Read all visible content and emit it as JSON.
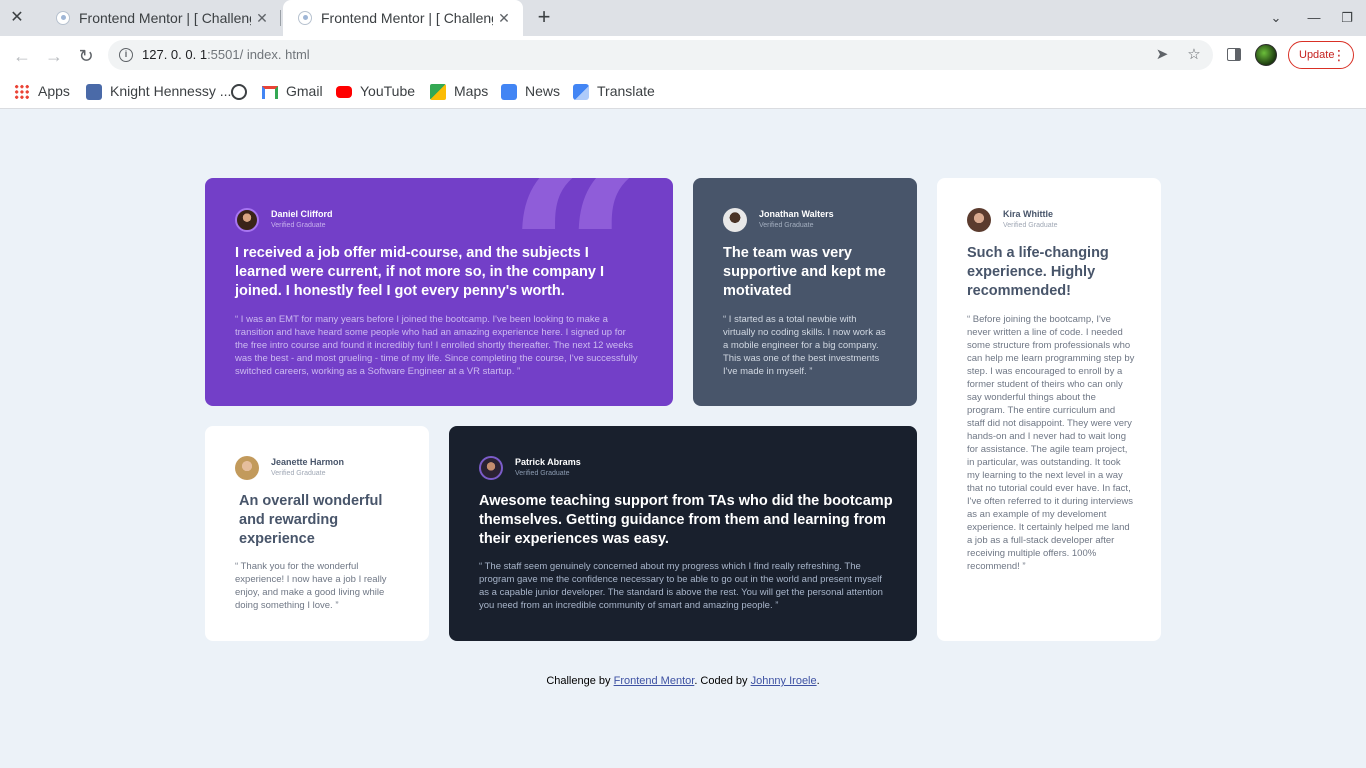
{
  "browser": {
    "tabs": [
      {
        "title": "Frontend Mentor | [ Challenge",
        "close": "✕"
      },
      {
        "title": "Frontend Mentor | [ Challenge",
        "close": "✕"
      }
    ],
    "new_tab": "+",
    "url_host": "127. 0. 0. 1",
    "url_rest": ":5501/ index. html",
    "update_label": "Update",
    "bookmarks": [
      {
        "label": "Apps",
        "icon": "apps-grid-icon"
      },
      {
        "label": "Knight Hennessy ...",
        "icon": "knight-hennessy-icon"
      },
      {
        "label": "",
        "icon": "globe-icon"
      },
      {
        "label": "Gmail",
        "icon": "gmail-icon"
      },
      {
        "label": "YouTube",
        "icon": "youtube-icon"
      },
      {
        "label": "Maps",
        "icon": "maps-icon"
      },
      {
        "label": "News",
        "icon": "news-icon"
      },
      {
        "label": "Translate",
        "icon": "translate-icon"
      }
    ]
  },
  "testimonials": [
    {
      "name": "Daniel Clifford",
      "role": "Verified Graduate",
      "headline": "I received a job offer mid-course, and the subjects I learned were current, if not more so, in the company I joined. I honestly feel I got every penny's worth.",
      "body": "“ I was an EMT for many years before I joined the bootcamp. I've been looking to make a transition and have heard some people who had an amazing experience here. I signed up for the free intro course and found it incredibly fun! I enrolled shortly thereafter. The next 12 weeks was the best - and most grueling - time of my life. Since completing the course, I've successfully switched careers, working as a Software Engineer at a VR startup. ”"
    },
    {
      "name": "Jonathan Walters",
      "role": "Verified Graduate",
      "headline": "The team was very supportive and kept me motivated",
      "body": "“ I started as a total newbie with virtually no coding skills. I now work as a mobile engineer for a big company. This was one of the best investments I've made in myself. ”"
    },
    {
      "name": "Kira Whittle",
      "role": "Verified Graduate",
      "headline": "Such a life-changing experience. Highly recommended!",
      "body": "“ Before joining the bootcamp, I've never written a line of code. I needed some structure from professionals who can help me learn programming step by step. I was encouraged to enroll by a former student of theirs who can only say wonderful things about the program. The entire curriculum and staff did not disappoint. They were very hands-on and I never had to wait long for assistance. The agile team project, in particular, was outstanding. It took my learning to the next level in a way that no tutorial could ever have. In fact, I've often referred to it during interviews as an example of my develoment experience. It certainly helped me land a job as a full-stack developer after receiving multiple offers. 100% recommend! ”"
    },
    {
      "name": "Jeanette Harmon",
      "role": "Verified Graduate",
      "headline": "An overall wonderful and rewarding experience",
      "body": "“ Thank you for the wonderful experience! I now have a job I really enjoy, and make a good living while doing something I love. ”"
    },
    {
      "name": "Patrick Abrams",
      "role": "Verified Graduate",
      "headline": "Awesome teaching support from TAs who did the bootcamp themselves. Getting guidance from them and learning from their experiences was easy.",
      "body": "“ The staff seem genuinely concerned about my progress which I find really refreshing. The program gave me the confidence necessary to be able to go out in the world and present myself as a capable junior developer. The standard is above the rest. You will get the personal attention you need from an incredible community of smart and amazing people. ”"
    }
  ],
  "attribution": {
    "prefix": "Challenge by ",
    "link1": "Frontend Mentor",
    "middle": ". Coded by ",
    "link2": "Johnny Iroele",
    "suffix": "."
  },
  "colors": {
    "purple": "#733fc8",
    "slate": "#48556a",
    "dark": "#19202d",
    "background": "#ecf2f8"
  }
}
